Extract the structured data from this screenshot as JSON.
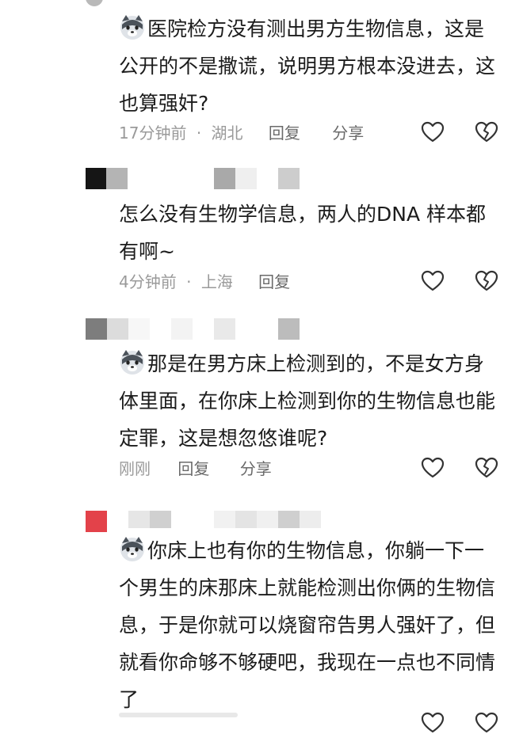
{
  "comments": [
    {
      "text": "医院检方没有测出男方生物信息，这是公开的不是撒谎，说明男方根本没进去，这也算强奸?",
      "has_emoji": true,
      "time": "17分钟前",
      "location": "湖北",
      "reply_label": "回复",
      "share_label": "分享"
    },
    {
      "text": "怎么没有生物学信息，两人的DNA 样本都有啊~",
      "has_emoji": false,
      "time": "4分钟前",
      "location": "上海",
      "reply_label": "回复"
    },
    {
      "text": "那是在男方床上检测到的，不是女方身体里面，在你床上检测到你的生物信息也能定罪，这是想忽悠谁呢?",
      "has_emoji": true,
      "time": "刚刚",
      "reply_label": "回复",
      "share_label": "分享"
    },
    {
      "text": "你床上也有你的生物信息，你躺一下一个男生的床那床上就能检测出你俩的生物信息，于是你就可以烧窗帘告男人强奸了，但就看你命够不够硬吧，我现在一点也不同情了",
      "has_emoji": true
    }
  ],
  "meta_separator": "·",
  "icons": {
    "like": "heart-outline-icon",
    "dislike": "broken-heart-icon",
    "emoji": "wolf-emoji-icon"
  },
  "colors": {
    "text": "#1c1c1c",
    "meta": "#9a9a9a",
    "pixel_red": "#e3424a"
  }
}
